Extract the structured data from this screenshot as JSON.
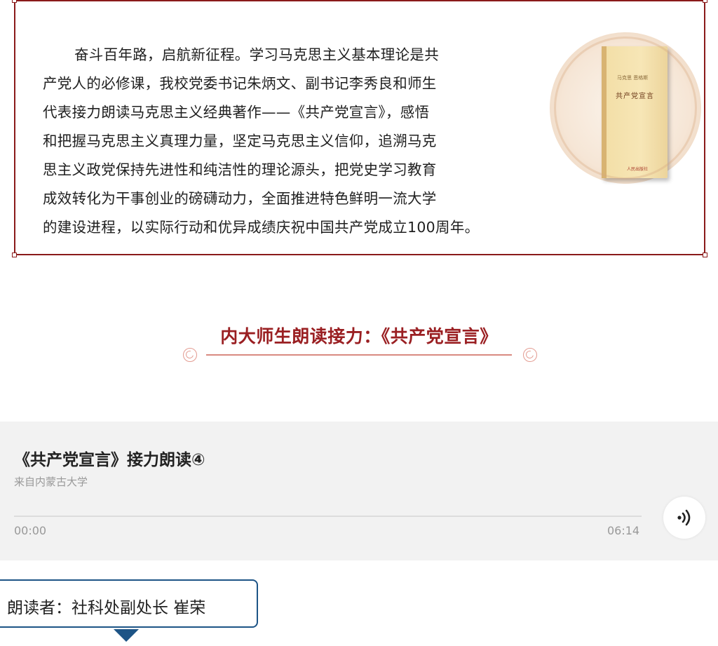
{
  "intro": {
    "lines": [
      "奋斗百年路，启航新征程。学习马克思主义基本理论是共",
      "产党人的必修课，我校党委书记朱炳文、副书记李秀良和师生",
      "代表接力朗读马克思主义经典著作——《共产党宣言》，感悟",
      "和把握马克思主义真理力量，坚定马克思主义信仰，追溯马克",
      "思主义政党保持先进性和纯洁性的理论源头，把党史学习教育",
      "成效转化为干事创业的磅礴动力，全面推进特色鲜明一流大学",
      "的建设进程，以实际行动和优异成绩庆祝中国共产党成立100周年。"
    ],
    "book": {
      "author": "马克思 恩格斯",
      "title": "共产党宣言",
      "publisher": "人民出版社"
    }
  },
  "section": {
    "title": "内大师生朗读接力：《共产党宣言》"
  },
  "player": {
    "title": "《共产党宣言》接力朗读④",
    "source": "来自内蒙古大学",
    "current_time": "00:00",
    "total_time": "06:14",
    "progress": 0,
    "icon": "play-audio-icon",
    "accent_color": "#9a1f22"
  },
  "reader": {
    "label": "朗读者：社科处副处长 崔荣",
    "border_color": "#1d5486"
  },
  "colors": {
    "frame": "#8a1a1a",
    "heading": "#9a1f22",
    "rule": "#d98a80",
    "player_bg": "#f2f2f2"
  }
}
